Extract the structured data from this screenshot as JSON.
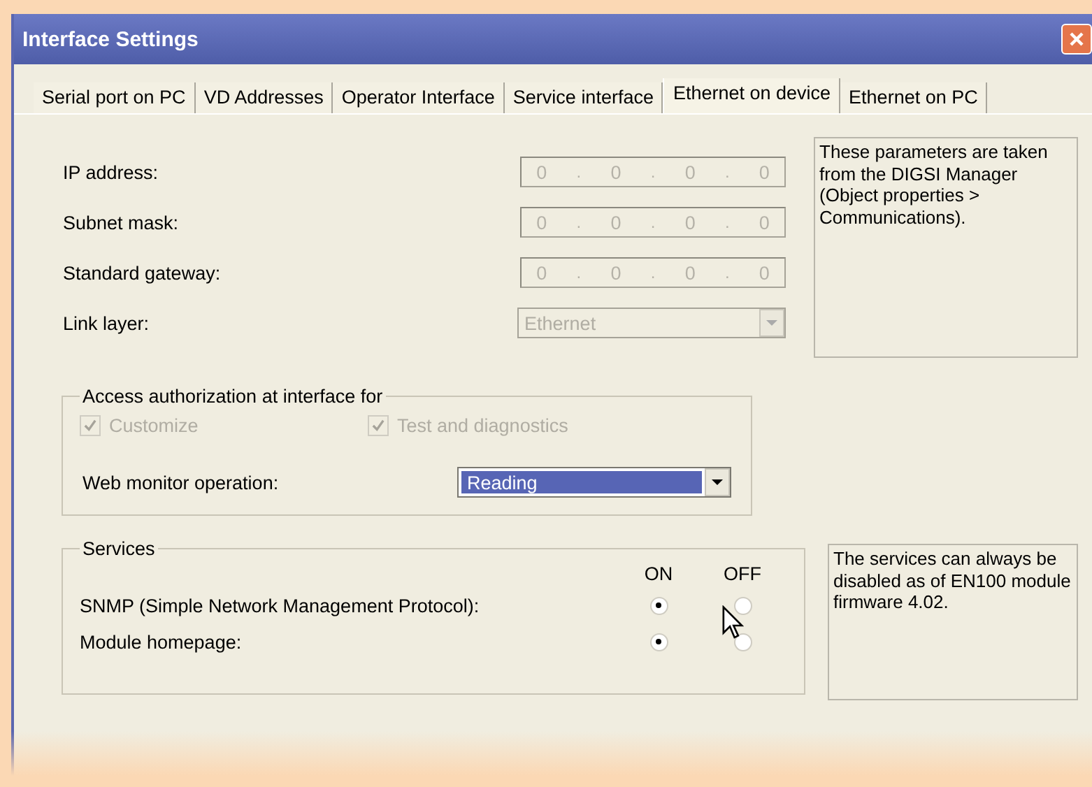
{
  "window": {
    "title": "Interface Settings"
  },
  "tabs": [
    {
      "label": "Serial port on PC",
      "selected": false
    },
    {
      "label": "VD Addresses",
      "selected": false
    },
    {
      "label": "Operator Interface",
      "selected": false
    },
    {
      "label": "Service interface",
      "selected": false
    },
    {
      "label": "Ethernet on device",
      "selected": true
    },
    {
      "label": "Ethernet on PC",
      "selected": false
    }
  ],
  "address_fields": [
    {
      "label": "IP address:",
      "octets": [
        "0",
        "0",
        "0",
        "0"
      ],
      "separator": ".",
      "disabled": true
    },
    {
      "label": "Subnet mask:",
      "octets": [
        "0",
        "0",
        "0",
        "0"
      ],
      "separator": ".",
      "disabled": true
    },
    {
      "label": "Standard gateway:",
      "octets": [
        "0",
        "0",
        "0",
        "0"
      ],
      "separator": ".",
      "disabled": true
    }
  ],
  "link_layer": {
    "label": "Link layer:",
    "value": "Ethernet",
    "disabled": true
  },
  "info_note": "These parameters are taken from the DIGSI Manager (Object properties > Communications).",
  "access": {
    "title": "Access authorization at interface for",
    "checkboxes": [
      {
        "label": "Customize",
        "checked": true,
        "disabled": true
      },
      {
        "label": "Test and diagnostics",
        "checked": true,
        "disabled": true
      }
    ],
    "web_monitor": {
      "label": "Web monitor operation:",
      "value": "Reading",
      "highlighted": true
    }
  },
  "services": {
    "title": "Services",
    "columns": [
      "ON",
      "OFF"
    ],
    "rows": [
      {
        "label": "SNMP (Simple Network Management Protocol):",
        "options": [
          {
            "selected": true
          },
          {
            "selected": false
          }
        ]
      },
      {
        "label": "Module homepage:",
        "options": [
          {
            "selected": true
          },
          {
            "selected": false
          }
        ]
      }
    ]
  },
  "services_note": "The services can always be disabled as of EN100 module firmware 4.02."
}
